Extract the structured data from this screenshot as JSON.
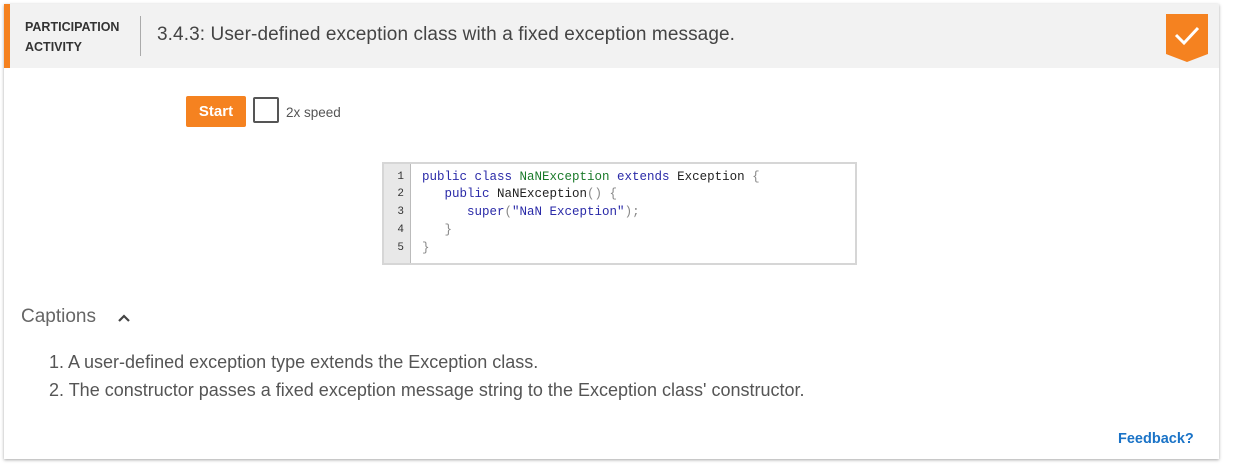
{
  "header": {
    "activity_type_line1": "PARTICIPATION",
    "activity_type_line2": "ACTIVITY",
    "title": "3.4.3: User-defined exception class with a fixed exception message.",
    "completion_icon": "checkmark-icon",
    "accent_color": "#f58220"
  },
  "controls": {
    "start_label": "Start",
    "speed_label": "2x speed"
  },
  "code": {
    "line_numbers": [
      "1",
      "2",
      "3",
      "4",
      "5"
    ],
    "lines": [
      {
        "t1": "public class ",
        "t2": "NaNException",
        "t3": " extends ",
        "t4": "Exception",
        "t5": " {"
      },
      {
        "t1": "   public ",
        "t2": "NaNException",
        "t3": "() {"
      },
      {
        "t1": "      super",
        "t2": "(",
        "t3": "\"NaN Exception\"",
        "t4": ");"
      },
      {
        "t1": "   }"
      },
      {
        "t1": "}"
      }
    ]
  },
  "captions": {
    "toggle_label": "Captions",
    "items": [
      "1. A user-defined exception type extends the Exception class.",
      "2. The constructor passes a fixed exception message string to the Exception class' constructor."
    ]
  },
  "footer": {
    "feedback_label": "Feedback?"
  }
}
